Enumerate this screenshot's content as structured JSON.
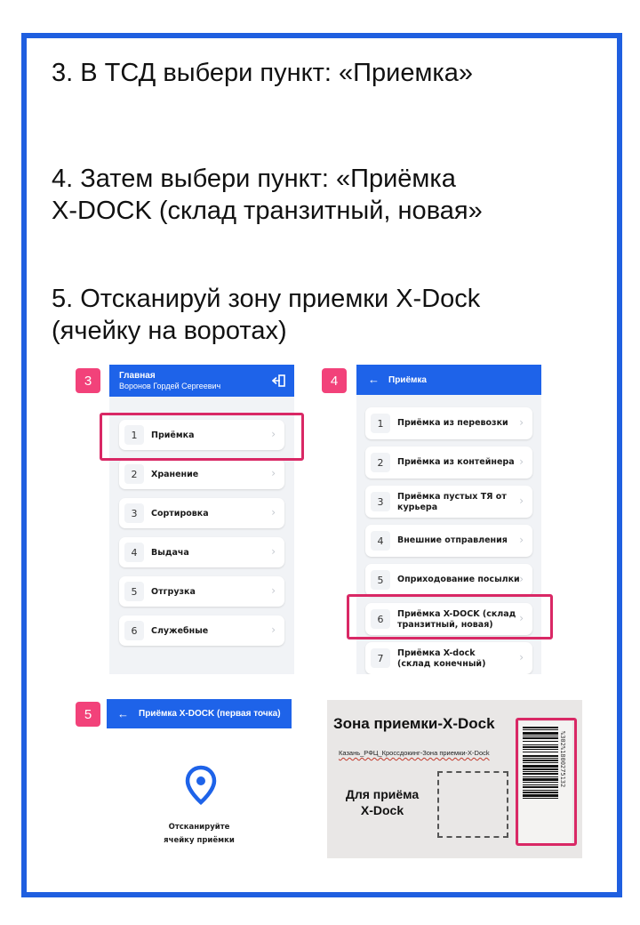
{
  "instructions": {
    "step3": "3. В ТСД выбери пункт: «Приемка»",
    "step4": [
      "4. Затем выбери пункт: «Приёмка",
      "X-DOCK (склад транзитный, новая»"
    ],
    "step5": [
      "5. Отсканируй зону приемки X-Dock",
      "(ячейку на воротах)"
    ]
  },
  "screen3": {
    "badge": "3",
    "title": "Главная",
    "user": "Воронов Гордей Сергеевич",
    "exit_icon": "logout-icon",
    "items": [
      {
        "num": "1",
        "label": "Приёмка"
      },
      {
        "num": "2",
        "label": "Хранение"
      },
      {
        "num": "3",
        "label": "Сортировка"
      },
      {
        "num": "4",
        "label": "Выдача"
      },
      {
        "num": "5",
        "label": "Отгрузка"
      },
      {
        "num": "6",
        "label": "Служебные"
      }
    ]
  },
  "screen4": {
    "badge": "4",
    "title": "Приёмка",
    "items": [
      {
        "num": "1",
        "label": "Приёмка из перевозки"
      },
      {
        "num": "2",
        "label": "Приёмка из контейнера"
      },
      {
        "num": "3",
        "label": [
          "Приёмка пустых ТЯ от",
          "курьера"
        ]
      },
      {
        "num": "4",
        "label": "Внешние отправления"
      },
      {
        "num": "5",
        "label": "Оприходование посылки"
      },
      {
        "num": "6",
        "label": [
          "Приёмка X-DOCK (склад",
          "транзитный, новая)"
        ]
      },
      {
        "num": "7",
        "label": [
          "Приёмка X-dock",
          "(склад конечный)"
        ]
      }
    ]
  },
  "screen5": {
    "badge": "5",
    "title": "Приёмка X-DOCK (первая точка)",
    "prompt": [
      "Отсканируйте",
      "ячейку приёмки"
    ],
    "icon": "location-pin-icon"
  },
  "zone_label": {
    "title": "Зона приемки-X-Dock",
    "subtitle": "Казань_РФЦ_Кроссдокинг-Зона приемки-X-Dock",
    "caption": [
      "Для приёма",
      "X-Dock"
    ],
    "barcode_text": "%302%1800275132"
  },
  "colors": {
    "frame_border": "#1f5fe0",
    "header_blue": "#1e63e9",
    "badge_pink": "#f2427a",
    "highlight": "#d92865"
  }
}
